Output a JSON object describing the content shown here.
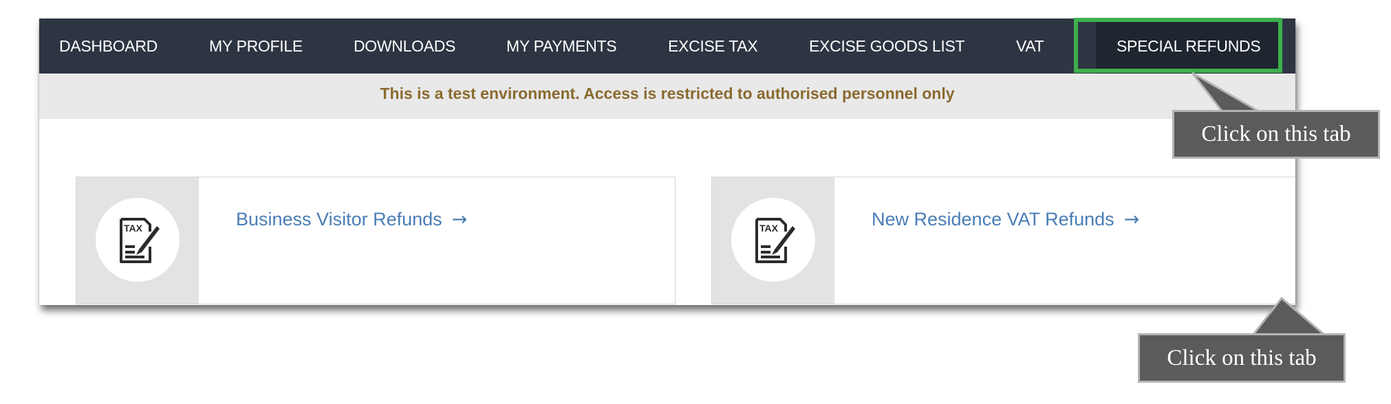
{
  "nav": {
    "items": [
      {
        "label": "DASHBOARD"
      },
      {
        "label": "MY PROFILE"
      },
      {
        "label": "DOWNLOADS"
      },
      {
        "label": "MY PAYMENTS"
      },
      {
        "label": "EXCISE TAX"
      },
      {
        "label": "EXCISE GOODS LIST"
      },
      {
        "label": "VAT"
      },
      {
        "label": "SPECIAL REFUNDS",
        "active": true
      }
    ]
  },
  "notice": {
    "text": "This is a test environment. Access is restricted to authorised personnel only"
  },
  "cards": [
    {
      "label": "Business Visitor Refunds",
      "arrow": "→",
      "icon": "tax-form-icon",
      "icon_text": "TAX"
    },
    {
      "label": "New Residence VAT Refunds",
      "arrow": "→",
      "icon": "tax-form-icon",
      "icon_text": "TAX"
    }
  ],
  "callouts": [
    {
      "text": "Click on this tab"
    },
    {
      "text": "Click on this tab"
    }
  ],
  "colors": {
    "navbar": "#2d3542",
    "highlight": "#3daf4c",
    "notice_text": "#8a6a2f",
    "link": "#4a7db5",
    "callout": "#5b5b5b"
  }
}
